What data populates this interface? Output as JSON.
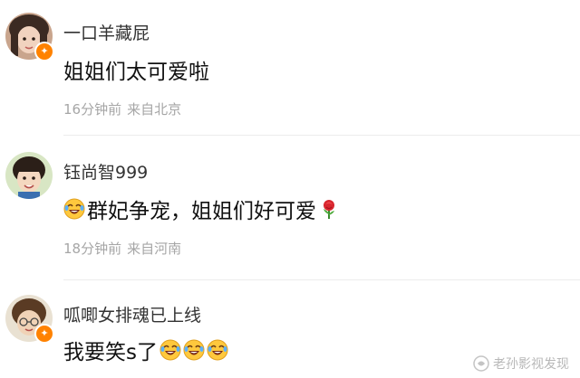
{
  "comments": [
    {
      "username": "一口羊藏屁",
      "text": "姐姐们太可爱啦",
      "time": "16分钟前",
      "location": "来自北京",
      "vip": true
    },
    {
      "username": "钰尚智999",
      "text": "群妃争宠，姐姐们好可爱",
      "time": "18分钟前",
      "location": "来自河南",
      "vip": false,
      "leading_emoji": "laugh-cry-emoji",
      "trailing_emoji": "rose-emoji"
    },
    {
      "username": "呱唧女排魂已上线",
      "text": "我要笑s了",
      "vip": true,
      "trailing_emojis": [
        "laugh-cry-emoji",
        "laugh-cry-emoji",
        "laugh-cry-emoji"
      ]
    }
  ],
  "vip_badge_symbol": "✦",
  "watermark": "老孙影视发现",
  "colors": {
    "badge": "#ff8200",
    "meta": "#a6a6a6",
    "text": "#111111"
  }
}
